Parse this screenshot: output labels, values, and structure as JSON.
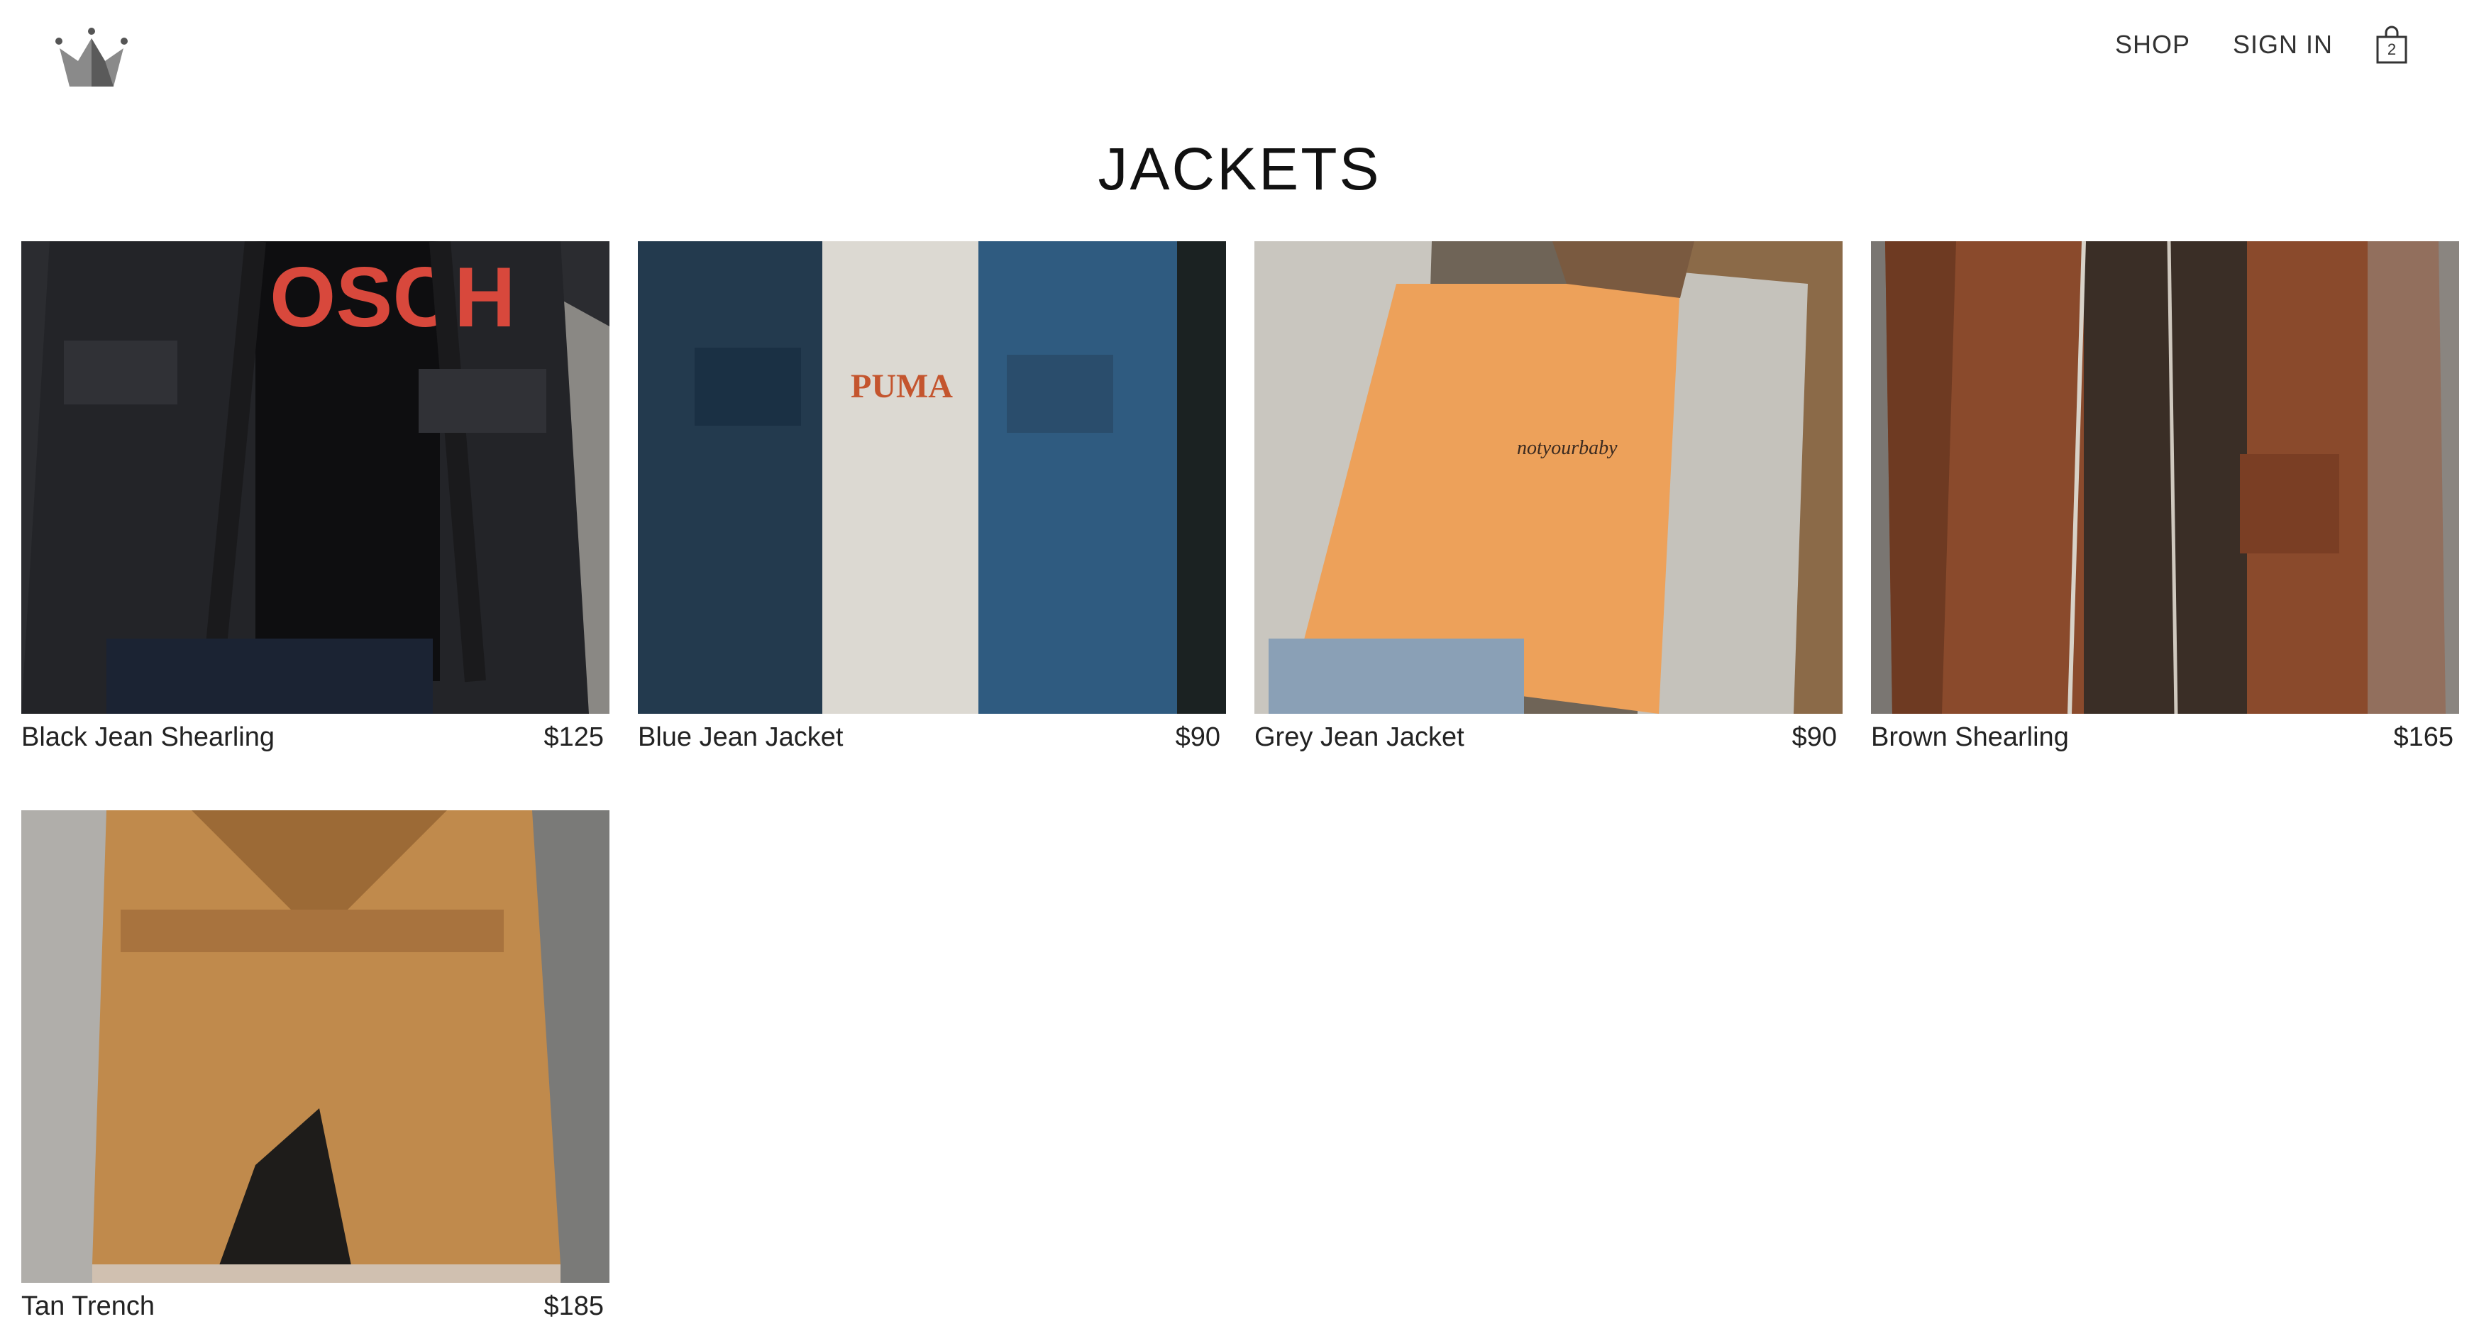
{
  "header": {
    "logo_icon": "crown-icon",
    "nav": {
      "shop_label": "SHOP",
      "signin_label": "SIGN IN"
    },
    "cart": {
      "icon": "shopping-bag-icon",
      "count": "2"
    }
  },
  "collection": {
    "title": "JACKETS",
    "products": [
      {
        "name": "Black Jean Shearling",
        "price": "$125",
        "image_colors": [
          "#2b2c30",
          "#0e0e10",
          "#d8483c"
        ]
      },
      {
        "name": "Blue Jean Jacket",
        "price": "$90",
        "image_colors": [
          "#1f3446",
          "#2f5b80",
          "#dcd9d2"
        ]
      },
      {
        "name": "Grey Jean Jacket",
        "price": "$90",
        "image_colors": [
          "#6f6457",
          "#c9c6bf",
          "#eda15a"
        ]
      },
      {
        "name": "Brown Shearling",
        "price": "$165",
        "image_colors": [
          "#7a7672",
          "#8a4a2c",
          "#3a2e26"
        ]
      },
      {
        "name": "Tan Trench",
        "price": "$185",
        "image_colors": [
          "#9a9a98",
          "#c08a4c",
          "#1e1c1a"
        ]
      }
    ]
  }
}
